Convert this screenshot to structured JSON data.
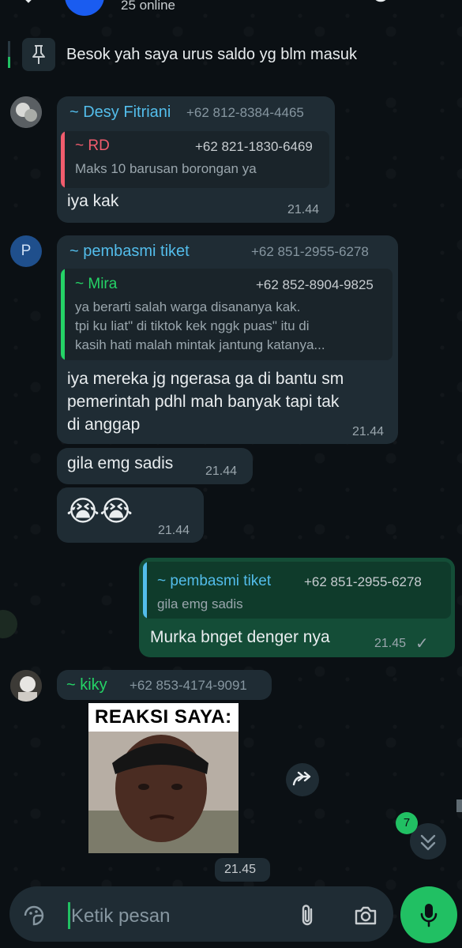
{
  "header": {
    "online_text": "25 online"
  },
  "pinned": {
    "text": "Besok yah saya urus saldo yg blm masuk"
  },
  "messages": [
    {
      "sender": "~ Desy Fitriani",
      "phone": "+62 812-8384-4465",
      "name_color": "#53bdeb",
      "quote": {
        "name": "~ RD",
        "phone": "+62 821-1830-6469",
        "text": [
          "Maks 10 barusan borongan ya"
        ],
        "color": "#f15c6d"
      },
      "text": [
        "iya kak"
      ],
      "time": "21.44"
    },
    {
      "avatar_letter": "P",
      "sender": "~ pembasmi tiket",
      "phone": "+62 851-2955-6278",
      "name_color": "#53bdeb",
      "quote": {
        "name": "~ Mira",
        "phone": "+62 852-8904-9825",
        "text": [
          "ya berarti salah warga disananya kak.",
          "tpi ku liat\" di tiktok kek nggk puas\" itu di",
          "kasih hati malah mintak jantung katanya..."
        ],
        "color": "#25d366"
      },
      "text": [
        "iya mereka jg ngerasa ga di bantu sm",
        "pemerintah pdhl mah banyak tapi tak",
        "di anggap"
      ],
      "time": "21.44"
    },
    {
      "text": [
        "gila emg sadis"
      ],
      "time": "21.44"
    },
    {
      "text": [
        "😭😭"
      ],
      "time": "21.44"
    },
    {
      "outgoing": true,
      "quote": {
        "name": "~ pembasmi tiket",
        "phone": "+62 851-2955-6278",
        "text": [
          "gila emg sadis"
        ],
        "color": "#53bdeb"
      },
      "text": [
        "Murka bnget denger nya"
      ],
      "time": "21.45",
      "status": "✓"
    },
    {
      "sender": "~ kiky",
      "phone": "+62 853-4174-9091",
      "name_color": "#25d366",
      "image_caption": "REAKSI SAYA:",
      "time": "21.45"
    }
  ],
  "scroll_badge": "7",
  "input": {
    "placeholder": "Ketik pesan"
  },
  "colors": {
    "accent": "#21c063",
    "incoming_bubble": "#1f2c34",
    "outgoing_bubble": "#144d37"
  }
}
